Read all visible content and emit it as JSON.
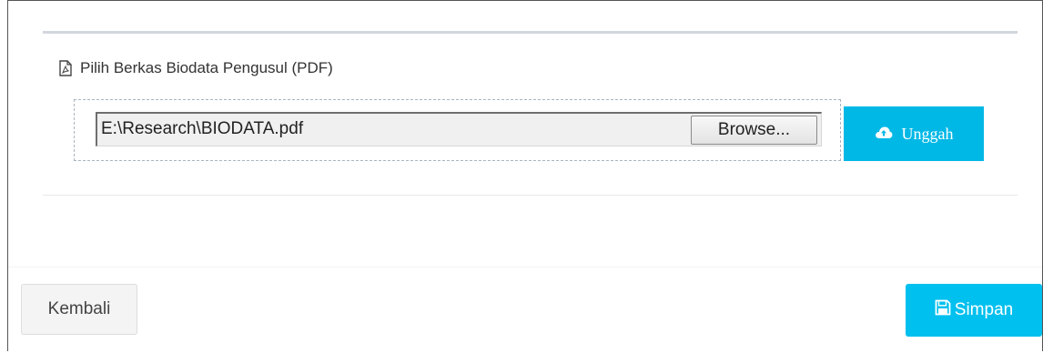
{
  "upload_panel": {
    "title": "Pilih Berkas Biodata Pengusul (PDF)",
    "title_icon": "file-pdf-icon",
    "file_input": {
      "value": "E:\\Research\\BIODATA.pdf",
      "browse_label": "Browse..."
    },
    "upload_button": {
      "label": "Unggah",
      "icon": "cloud-upload-icon"
    }
  },
  "footer": {
    "back_label": "Kembali",
    "save_label": "Simpan",
    "save_icon": "floppy-disk-icon"
  },
  "colors": {
    "accent": "#00c0ef",
    "panel_border": "#d2d6de",
    "default_button_bg": "#f4f4f4"
  }
}
